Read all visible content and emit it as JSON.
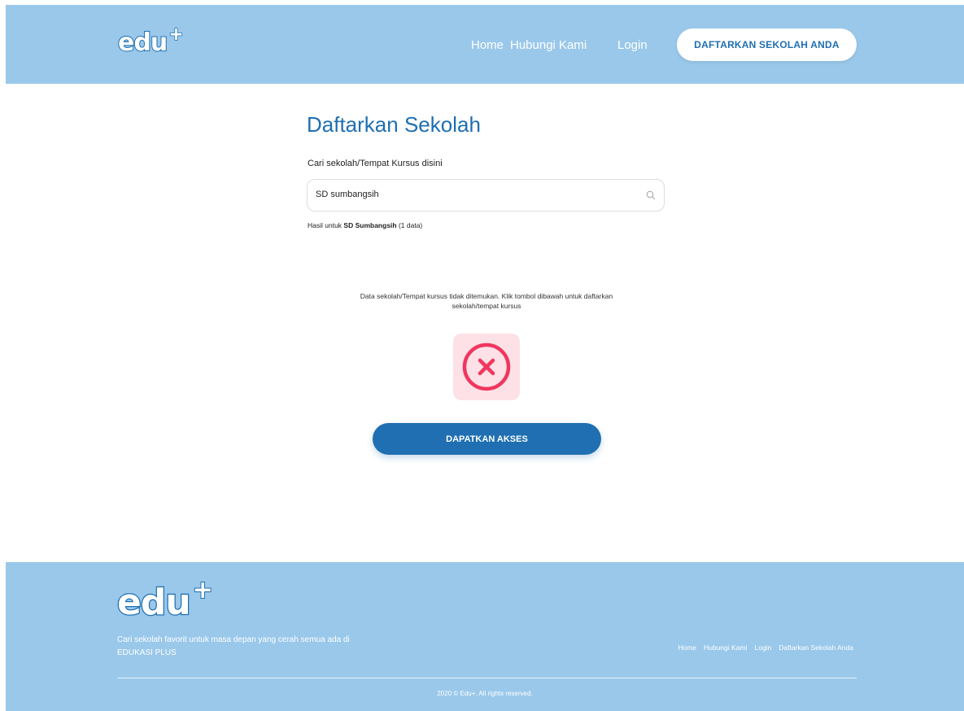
{
  "brand": {
    "logo_text": "edu",
    "logo_plus": "+"
  },
  "header": {
    "nav": [
      "Home",
      "Hubungi Kami",
      "Login"
    ],
    "cta": "DAFTARKAN SEKOLAH ANDA"
  },
  "main": {
    "title": "Daftarkan Sekolah",
    "search_label": "Cari sekolah/Tempat Kursus disini",
    "search_value": "SD sumbangsih",
    "result_prefix": "Hasil untuk ",
    "result_query": "SD Sumbangsih",
    "result_count": " (1 data)",
    "empty_message": "Data sekolah/Tempat kursus tidak ditemukan. Klik tombol dibawah untuk daftarkan sekolah/tempat kursus",
    "cta": "DAPATKAN AKSES"
  },
  "footer": {
    "tagline": "Cari sekolah favorit untuk masa depan yang cerah semua ada di EDUKASI PLUS",
    "links": [
      "Home",
      "Hubungi Kami",
      "Login",
      "Daftarkan Sekolah Anda"
    ],
    "copyright": "2020 © Edu+. All rights reserved."
  },
  "colors": {
    "header_bg": "#9ac8ea",
    "primary": "#1f6fb2",
    "error": "#f0365f",
    "error_bg": "#fde1e6"
  },
  "icons": [
    "search-icon",
    "x-circle-icon"
  ]
}
